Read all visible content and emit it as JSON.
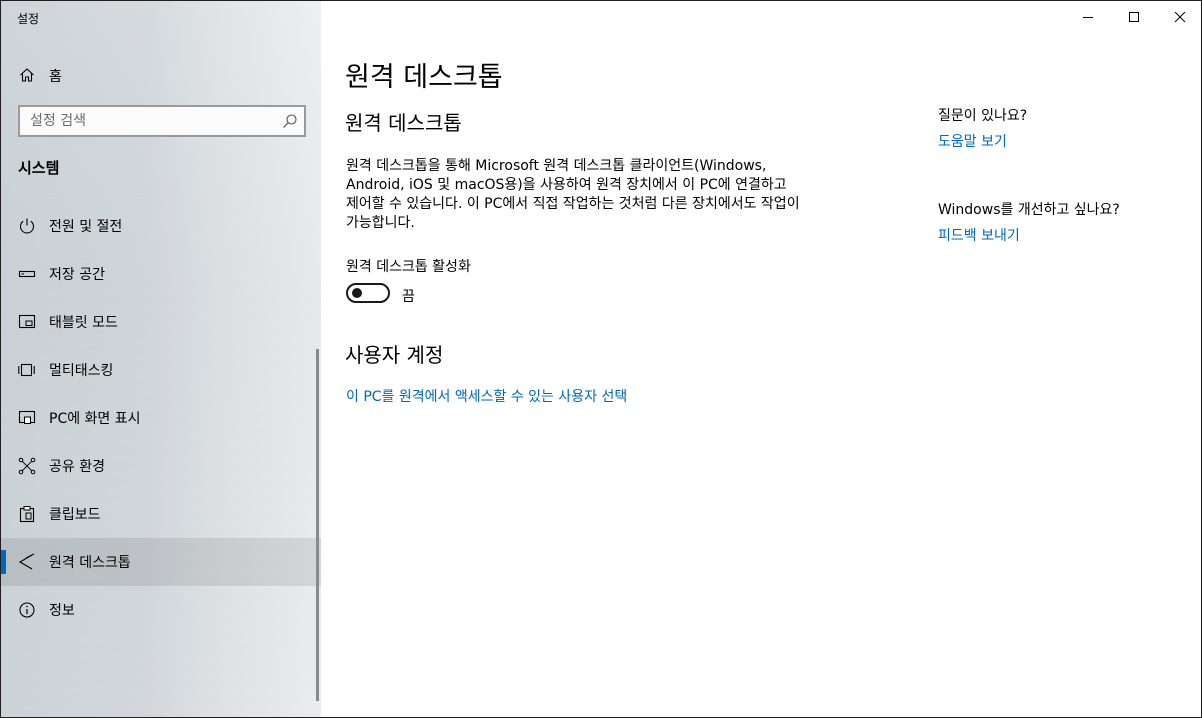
{
  "window": {
    "app_title": "설정",
    "controls": {
      "minimize": "minimize",
      "maximize": "maximize",
      "close": "close"
    }
  },
  "sidebar": {
    "home_label": "홈",
    "search_placeholder": "설정 검색",
    "section_title": "시스템",
    "items": [
      {
        "label": "전원 및 절전",
        "icon": "power-icon"
      },
      {
        "label": "저장 공간",
        "icon": "storage-icon"
      },
      {
        "label": "태블릿 모드",
        "icon": "tablet-icon"
      },
      {
        "label": "멀티태스킹",
        "icon": "multitasking-icon"
      },
      {
        "label": "PC에 화면 표시",
        "icon": "project-icon"
      },
      {
        "label": "공유 환경",
        "icon": "shared-experiences-icon"
      },
      {
        "label": "클립보드",
        "icon": "clipboard-icon"
      },
      {
        "label": "원격 데스크톱",
        "icon": "remote-desktop-icon",
        "active": true
      },
      {
        "label": "정보",
        "icon": "info-icon"
      }
    ],
    "accent_color": "#0067c0"
  },
  "main": {
    "page_title": "원격 데스크톱",
    "section1_title": "원격 데스크톱",
    "description": "원격 데스크톱을 통해 Microsoft 원격 데스크톱 클라이언트(Windows, Android, iOS 및 macOS용)을 사용하여 원격 장치에서 이 PC에 연결하고 제어할 수 있습니다. 이 PC에서 직접 작업하는 것처럼 다른 장치에서도 작업이 가능합니다.",
    "toggle_label": "원격 데스크톱 활성화",
    "toggle_state": "끔",
    "toggle_on": false,
    "section2_title": "사용자 계정",
    "user_link": "이 PC를 원격에서 액세스할 수 있는 사용자 선택",
    "link_color": "#0067b8"
  },
  "aside": {
    "question": "질문이 있나요?",
    "help_link": "도움말 보기",
    "improve": "Windows를 개선하고 싶나요?",
    "feedback_link": "피드백 보내기"
  }
}
